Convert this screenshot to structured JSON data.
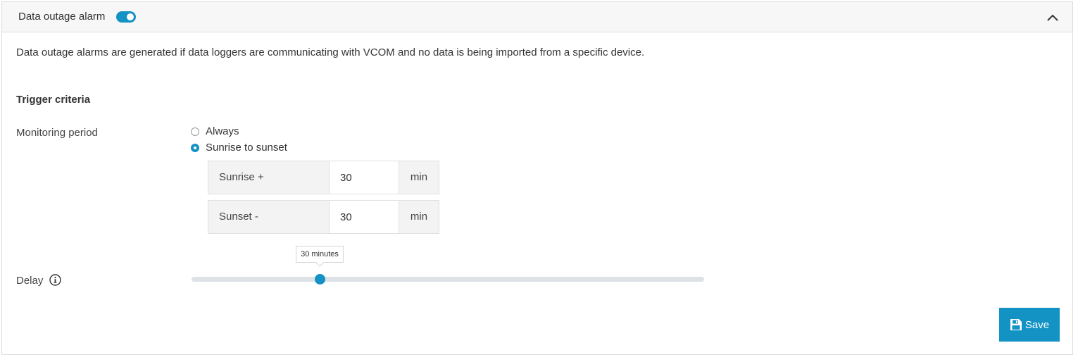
{
  "panel": {
    "title": "Data outage alarm",
    "enabled": true,
    "accent_color": "#1392c4"
  },
  "description": "Data outage alarms are generated if data loggers are communicating with VCOM and no data is being imported from a specific device.",
  "trigger_criteria": {
    "heading": "Trigger criteria",
    "monitoring_period": {
      "label": "Monitoring period",
      "options": [
        {
          "label": "Always",
          "selected": false
        },
        {
          "label": "Sunrise to sunset",
          "selected": true
        }
      ],
      "sunrise": {
        "prefix": "Sunrise +",
        "value": "30",
        "unit": "min"
      },
      "sunset": {
        "prefix": "Sunset -",
        "value": "30",
        "unit": "min"
      }
    },
    "delay": {
      "label": "Delay",
      "tooltip": "30 minutes",
      "position_fraction": 0.25
    }
  },
  "actions": {
    "save_label": "Save"
  }
}
